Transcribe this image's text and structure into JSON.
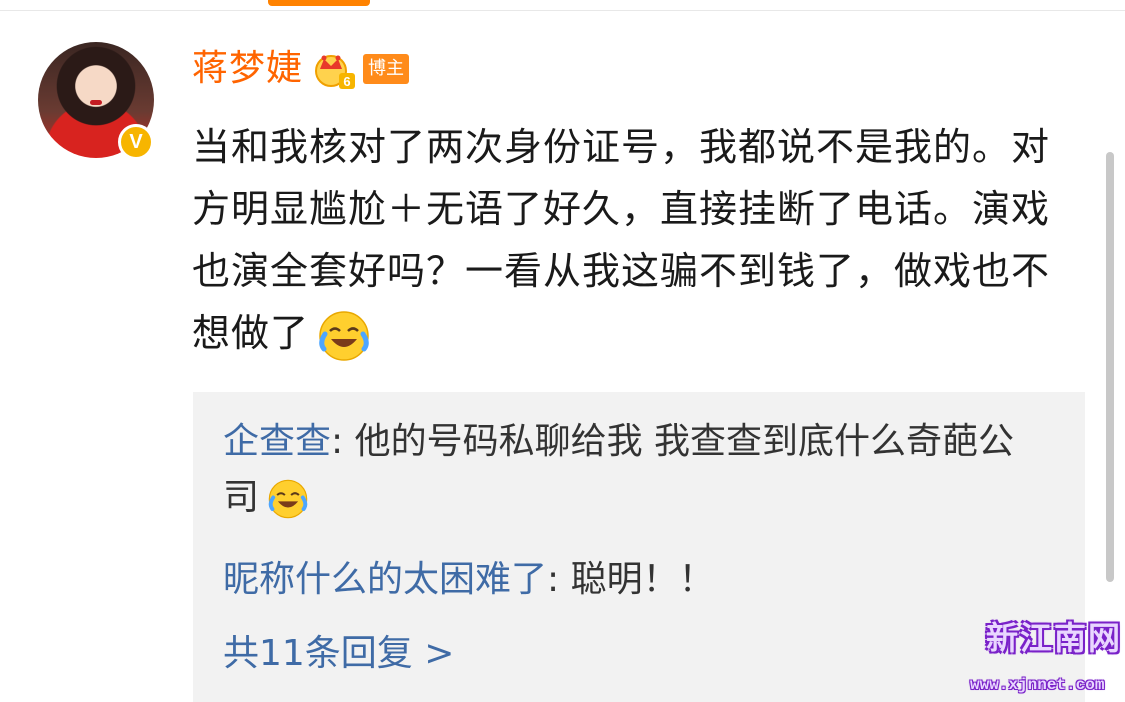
{
  "post": {
    "author": "蒋梦婕",
    "badge": "博主",
    "text": "当和我核对了两次身份证号，我都说不是我的。对方明显尴尬＋无语了好久，直接挂断了电话。演戏也演全套好吗？一看从我这骗不到钱了，做戏也不想做了",
    "emoji": "laughing-tears-emoji",
    "verified_icon": "verified-v-icon",
    "vip_icon": "crown-level-6-icon"
  },
  "replies": [
    {
      "user": "企查查",
      "separator": ": ",
      "text": "他的号码私聊给我 我查查到底什么奇葩公司"
    },
    {
      "user": "昵称什么的太困难了",
      "separator": ": ",
      "text": "聪明！！"
    }
  ],
  "more_replies": "共11条回复 >",
  "watermark": {
    "title": "新江南网",
    "url": "www.xjnnet.com"
  },
  "colors": {
    "author": "#ff6400",
    "reply_user": "#3f6ba6",
    "badge": "#ff8b1a",
    "reply_bg": "#f2f2f2"
  }
}
